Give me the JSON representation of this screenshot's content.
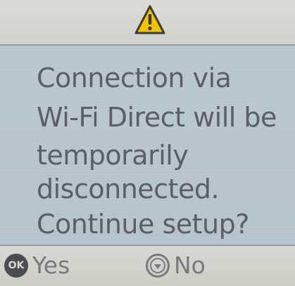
{
  "dialog": {
    "header_icon": "warning-icon",
    "message_lines": [
      "Connection via",
      "Wi-Fi Direct will be",
      "temporarily",
      "disconnected.",
      "Continue setup?"
    ]
  },
  "footer": {
    "yes_icon_text": "OK",
    "yes_label": "Yes",
    "no_icon": "down-circle-icon",
    "no_label": "No"
  },
  "colors": {
    "header": "#d8d8d2",
    "body": "#b9c7d1",
    "text": "#5b5f65",
    "footer_text": "#767b80",
    "warning_fill": "#f2c400",
    "warning_stroke": "#3b3b3b"
  }
}
